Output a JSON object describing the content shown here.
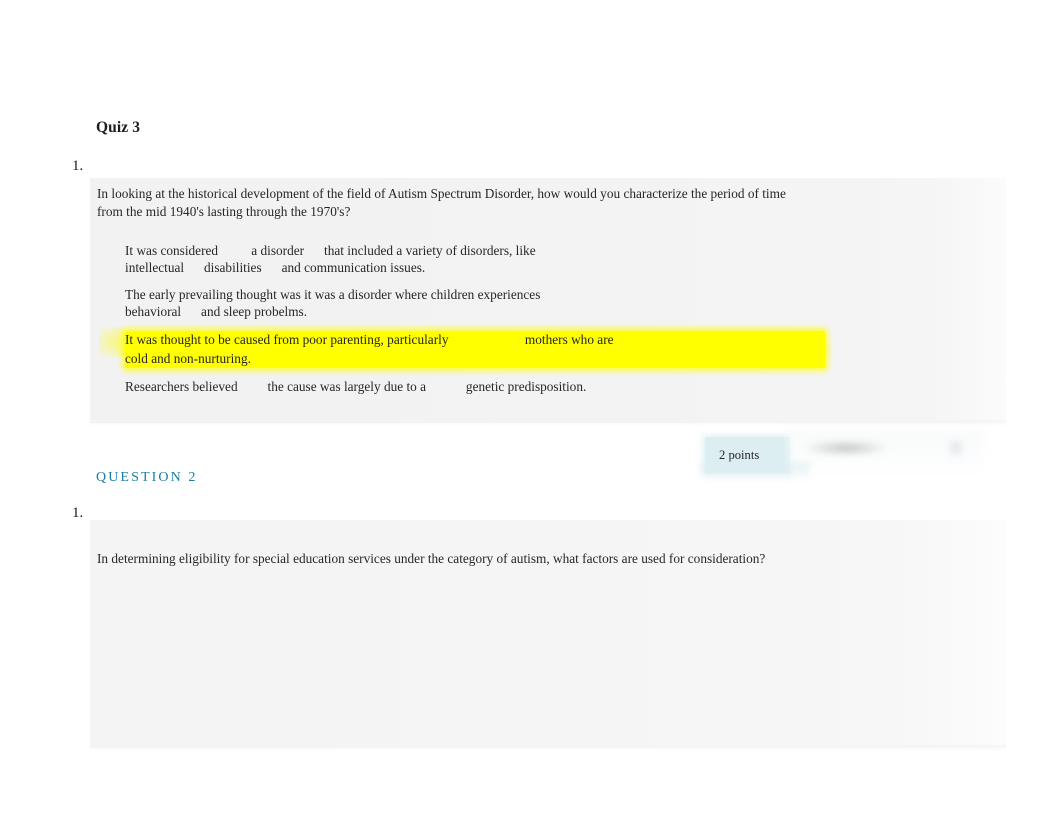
{
  "document": {
    "title": "Quiz 3"
  },
  "questions": [
    {
      "marker": "1.",
      "stem": "In looking at the historical development of the field of Autism Spectrum Disorder, how would you characterize the period of time\nfrom the mid 1940's lasting through the 1970's?",
      "options": [
        {
          "highlighted": false,
          "line1": "It was considered          a disorder      that included a variety of disorders, like",
          "line2": "intellectual      disabilities      and communication issues."
        },
        {
          "highlighted": false,
          "line1": "The early prevailing thought was it was a disorder where children experiences",
          "line2": "behavioral      and sleep probelms."
        },
        {
          "highlighted": true,
          "line1": "It was thought to be caused from poor parenting, particularly                       mothers who are",
          "line2": "cold and non-nurturing."
        },
        {
          "highlighted": false,
          "line1": "Researchers believed         the cause was largely due to a            genetic predisposition.",
          "line2": ""
        }
      ],
      "points_label": "2 points"
    },
    {
      "section_heading": "QUESTION 2",
      "marker": "1.",
      "stem": "In determining eligibility for special education services under the category of autism, what factors are used for consideration?",
      "options": []
    }
  ],
  "colors": {
    "heading_teal": "#1a7fa0",
    "highlight_yellow": "#ffff00",
    "panel_gray": "#f3f3f3",
    "badge_teal": "#dceef2"
  }
}
